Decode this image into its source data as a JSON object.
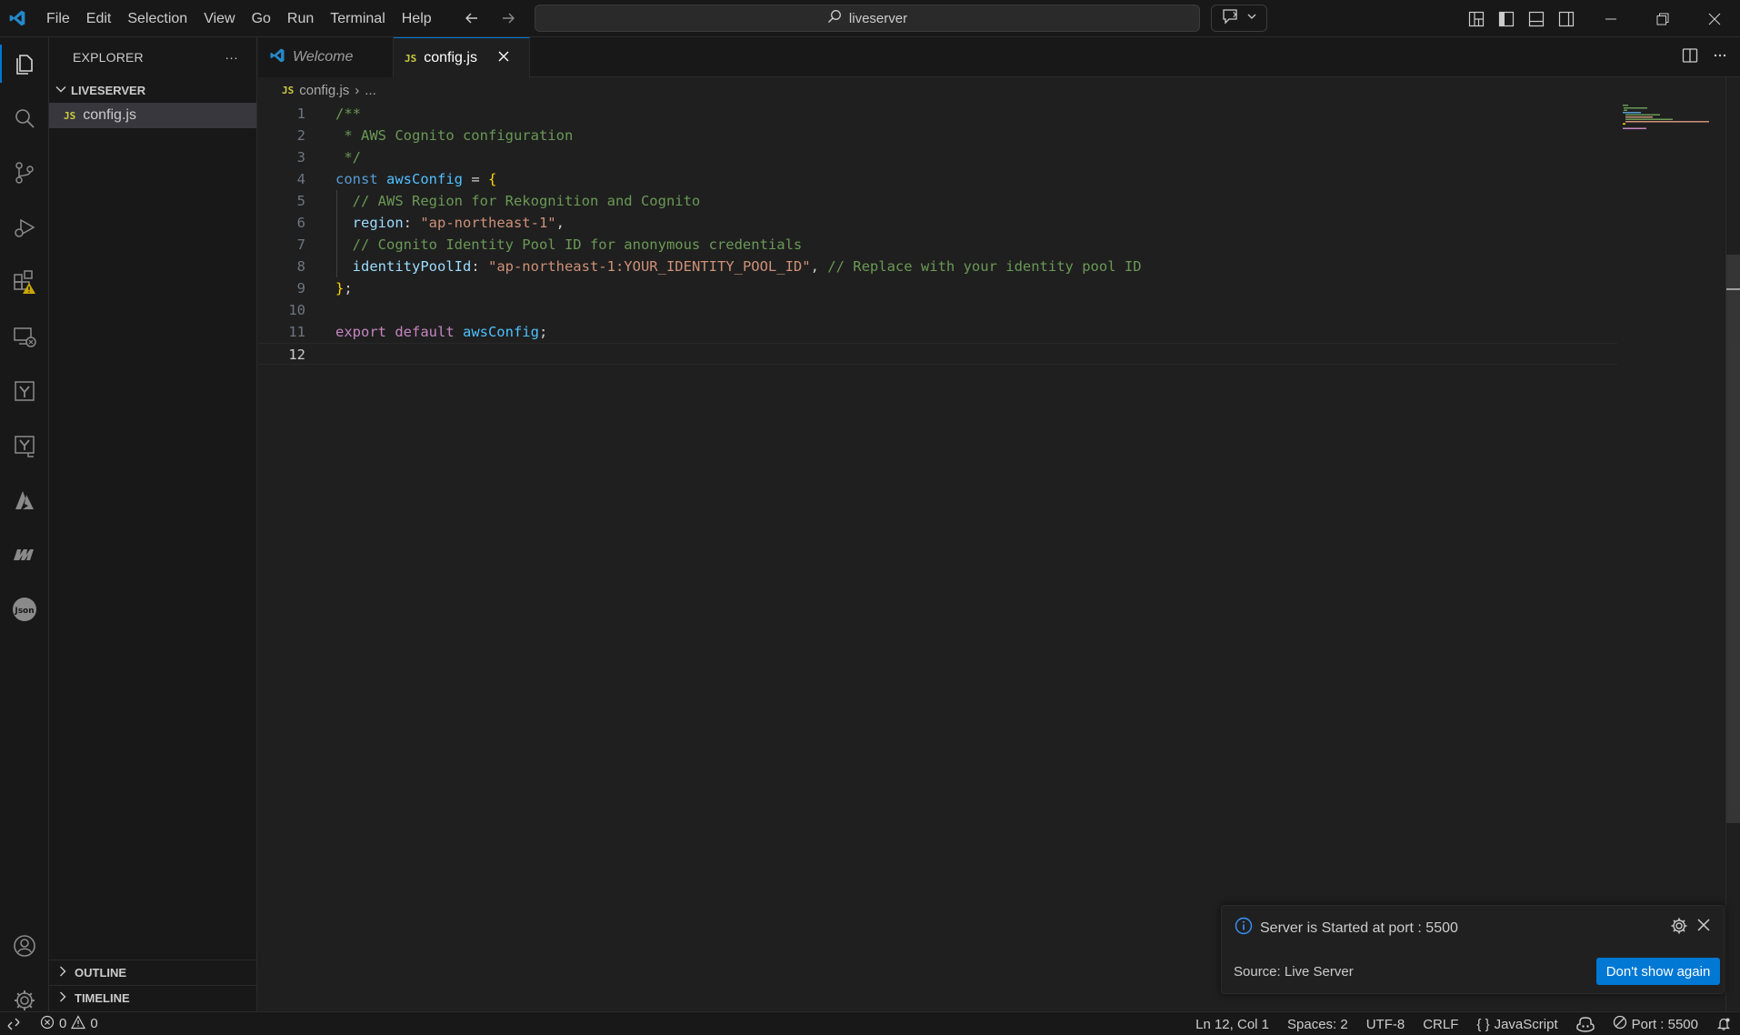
{
  "menu": {
    "items": [
      "File",
      "Edit",
      "Selection",
      "View",
      "Go",
      "Run",
      "Terminal",
      "Help"
    ]
  },
  "search": {
    "text": "liveserver"
  },
  "sidebar": {
    "title": "EXPLORER",
    "more": "···",
    "folder": "LIVESERVER",
    "file_badge": "JS",
    "file": "config.js",
    "outline": "OUTLINE",
    "timeline": "TIMELINE"
  },
  "tabs": {
    "welcome": "Welcome",
    "active_badge": "JS",
    "active": "config.js"
  },
  "breadcrumb": {
    "badge": "JS",
    "file": "config.js",
    "sep": "›",
    "more": "..."
  },
  "editor": {
    "line_numbers": [
      "1",
      "2",
      "3",
      "4",
      "5",
      "6",
      "7",
      "8",
      "9",
      "10",
      "11",
      "12"
    ],
    "lines": [
      [
        {
          "t": "/**",
          "c": "c-comment"
        }
      ],
      [
        {
          "t": " * AWS Cognito configuration",
          "c": "c-comment"
        }
      ],
      [
        {
          "t": " */",
          "c": "c-comment"
        }
      ],
      [
        {
          "t": "const ",
          "c": "c-keyword"
        },
        {
          "t": "awsConfig",
          "c": "c-var"
        },
        {
          "t": " = ",
          "c": "c-punc"
        },
        {
          "t": "{",
          "c": "c-brace"
        }
      ],
      [
        {
          "t": "  // AWS Region for Rekognition and Cognito",
          "c": "c-comment"
        }
      ],
      [
        {
          "t": "  region",
          "c": "c-prop"
        },
        {
          "t": ": ",
          "c": "c-punc"
        },
        {
          "t": "\"ap-northeast-1\"",
          "c": "c-string"
        },
        {
          "t": ",",
          "c": "c-punc"
        }
      ],
      [
        {
          "t": "  // Cognito Identity Pool ID for anonymous credentials",
          "c": "c-comment"
        }
      ],
      [
        {
          "t": "  identityPoolId",
          "c": "c-prop"
        },
        {
          "t": ": ",
          "c": "c-punc"
        },
        {
          "t": "\"ap-northeast-1:YOUR_IDENTITY_POOL_ID\"",
          "c": "c-string"
        },
        {
          "t": ", ",
          "c": "c-punc"
        },
        {
          "t": "// Replace with your identity pool ID",
          "c": "c-comment"
        }
      ],
      [
        {
          "t": "}",
          "c": "c-brace"
        },
        {
          "t": ";",
          "c": "c-punc"
        }
      ],
      [],
      [
        {
          "t": "export ",
          "c": "c-keyword2"
        },
        {
          "t": "default ",
          "c": "c-keyword2"
        },
        {
          "t": "awsConfig",
          "c": "c-var"
        },
        {
          "t": ";",
          "c": "c-punc"
        }
      ],
      []
    ]
  },
  "notification": {
    "message": "Server is Started at port : 5500",
    "source": "Source: Live Server",
    "button": "Don't show again"
  },
  "status": {
    "errors": "0",
    "warnings": "0",
    "position": "Ln 12, Col 1",
    "spaces": "Spaces: 2",
    "encoding": "UTF-8",
    "eol": "CRLF",
    "language": "JavaScript",
    "language_icon": "{ }",
    "port": "Port : 5500"
  },
  "colors": {
    "accent": "#0078d4",
    "background": "#1f1f1f",
    "chrome": "#181818"
  }
}
